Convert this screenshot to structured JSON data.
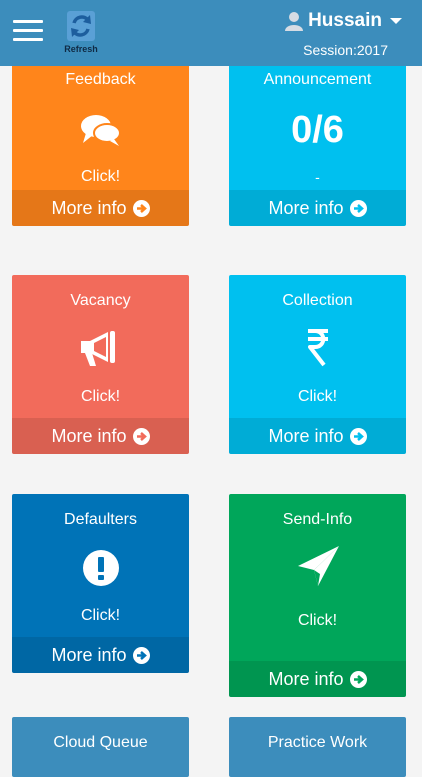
{
  "header": {
    "refresh_label": "Refresh",
    "user_name": "Hussain",
    "session": "Session:2017",
    "bar_color": "#3c8dbc"
  },
  "tiles": [
    {
      "title": "Feedback",
      "action": "Click!",
      "footer": "More info",
      "icon": "comments-icon",
      "color": "#ff851b"
    },
    {
      "title": "Announcement",
      "value": "0/6",
      "sub": "-",
      "footer": "More info",
      "color": "#00c0ef"
    },
    {
      "title": "Vacancy",
      "action": "Click!",
      "footer": "More info",
      "icon": "megaphone-icon",
      "color": "#f26b5b"
    },
    {
      "title": "Collection",
      "action": "Click!",
      "footer": "More info",
      "icon": "rupee-icon",
      "color": "#00c0ef"
    },
    {
      "title": "Defaulters",
      "action": "Click!",
      "footer": "More info",
      "icon": "exclamation-circle-icon",
      "color": "#0073b7"
    },
    {
      "title": "Send-Info",
      "action": "Click!",
      "footer": "More info",
      "icon": "paper-plane-icon",
      "color": "#00a65a"
    },
    {
      "title": "Cloud Queue",
      "color": "#3c8dbc"
    },
    {
      "title": "Practice Work",
      "color": "#3c8dbc"
    }
  ]
}
